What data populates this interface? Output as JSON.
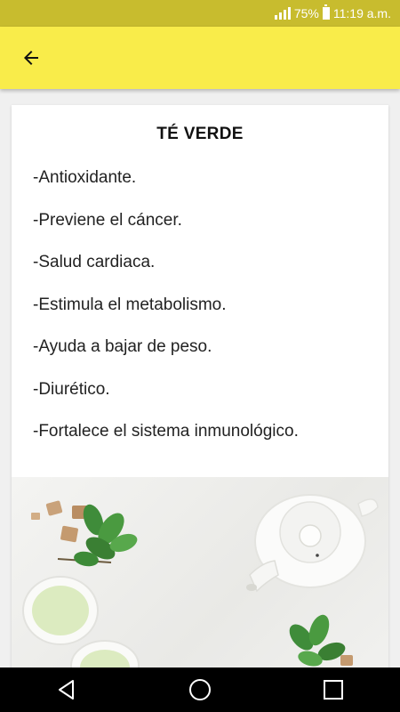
{
  "status_bar": {
    "battery_percent": "75%",
    "time": "11:19 a.m."
  },
  "app_bar": {
    "back_icon": "arrow-left-icon",
    "background": "#f9ec4a"
  },
  "card": {
    "title": "TÉ VERDE",
    "benefits": [
      "-Antioxidante.",
      "-Previene el cáncer.",
      "-Salud cardiaca.",
      "-Estimula el metabolismo.",
      "-Ayuda a bajar de peso.",
      "-Diurético.",
      "-Fortalece el sistema inmunológico."
    ]
  },
  "nav_bar": {
    "icons": [
      "back-triangle-icon",
      "home-circle-icon",
      "recents-square-icon"
    ]
  }
}
